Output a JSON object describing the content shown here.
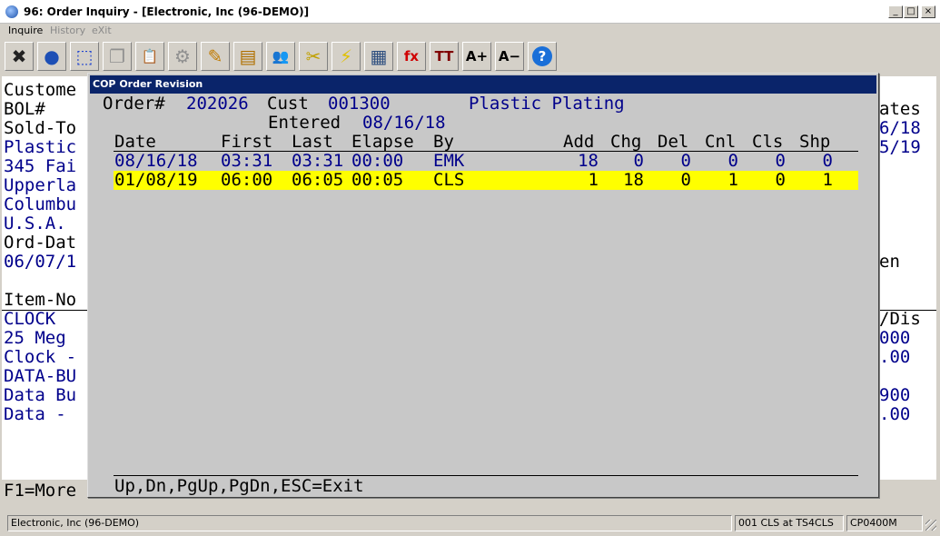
{
  "window": {
    "title": "96: Order Inquiry - [Electronic, Inc (96-DEMO)]",
    "buttons": {
      "minimize": "_",
      "maximize": "□",
      "close": "×"
    }
  },
  "menu": [
    {
      "label": "Inquire",
      "enabled": true
    },
    {
      "label": "History",
      "enabled": false
    },
    {
      "label": "eXit",
      "enabled": false
    }
  ],
  "toolbar": [
    {
      "icon": "close-x-icon",
      "glyph": "✖",
      "color": "#222222"
    },
    {
      "icon": "globe-icon",
      "glyph": "●",
      "color": "#1d4fb5"
    },
    {
      "icon": "select-icon",
      "glyph": "⬚",
      "color": "#1a3fd0"
    },
    {
      "icon": "copy-icon",
      "glyph": "❐",
      "color": "#909090"
    },
    {
      "icon": "paste-icon",
      "glyph": "📋",
      "color": "#909090"
    },
    {
      "icon": "gear-icon",
      "glyph": "⚙",
      "color": "#909090"
    },
    {
      "icon": "edit-icon",
      "glyph": "✎",
      "color": "#c07a00"
    },
    {
      "icon": "notepad-icon",
      "glyph": "▤",
      "color": "#b07000"
    },
    {
      "icon": "users-icon",
      "glyph": "👥",
      "color": "#2a7a2a"
    },
    {
      "icon": "tag-icon",
      "glyph": "✂",
      "color": "#c0a000"
    },
    {
      "icon": "lightning-icon",
      "glyph": "⚡",
      "color": "#e0c000"
    },
    {
      "icon": "calendar-lightning-icon",
      "glyph": "▦",
      "color": "#305080"
    },
    {
      "icon": "function-icon",
      "glyph": "fx",
      "color": "#d00000"
    },
    {
      "icon": "font-icon",
      "glyph": "TT",
      "color": "#800000"
    },
    {
      "icon": "font-increase-icon",
      "glyph": "A+",
      "color": "#000000"
    },
    {
      "icon": "font-decrease-icon",
      "glyph": "A−",
      "color": "#000000"
    },
    {
      "icon": "help-icon",
      "glyph": "?",
      "color": "#1a6fd8"
    }
  ],
  "background_screen": {
    "left_lines": [
      {
        "text": "Custome",
        "color": "black"
      },
      {
        "text": "BOL#",
        "color": "black"
      },
      {
        "text": "Sold-To",
        "color": "black"
      },
      {
        "text": "Plastic",
        "color": "blue"
      },
      {
        "text": "345 Fai",
        "color": "blue"
      },
      {
        "text": "Upperla",
        "color": "blue"
      },
      {
        "text": "Columbu",
        "color": "blue"
      },
      {
        "text": "U.S.A.",
        "color": "blue"
      },
      {
        "text": "Ord-Dat",
        "color": "black"
      },
      {
        "text": "06/07/1",
        "color": "blue"
      },
      {
        "text": "",
        "color": "black"
      },
      {
        "text": "Item-No",
        "color": "black"
      },
      {
        "text": "CLOCK",
        "color": "blue"
      },
      {
        "text": "25 Meg",
        "color": "blue"
      },
      {
        "text": "Clock -",
        "color": "blue"
      },
      {
        "text": "DATA-BU",
        "color": "blue"
      },
      {
        "text": "Data Bu",
        "color": "blue"
      },
      {
        "text": "Data -",
        "color": "blue"
      }
    ],
    "right_lines": [
      {
        "text": "ates",
        "color": "black"
      },
      {
        "text": "6/18",
        "color": "blue"
      },
      {
        "text": "5/19",
        "color": "blue"
      },
      {
        "text": "",
        "color": "black"
      },
      {
        "text": "",
        "color": "black"
      },
      {
        "text": "",
        "color": "black"
      },
      {
        "text": "",
        "color": "black"
      },
      {
        "text": "",
        "color": "black"
      },
      {
        "text": "en",
        "color": "black"
      },
      {
        "text": "",
        "color": "black"
      },
      {
        "text": "",
        "color": "black"
      },
      {
        "text": "/Dis",
        "color": "black"
      },
      {
        "text": "000",
        "color": "blue"
      },
      {
        "text": ".00",
        "color": "blue"
      },
      {
        "text": "",
        "color": "black"
      },
      {
        "text": "900",
        "color": "blue"
      },
      {
        "text": ".00",
        "color": "blue"
      }
    ],
    "f1_text": "F1=More"
  },
  "dialog": {
    "title": "COP Order Revision",
    "order_label": "Order#",
    "order_number": "202026",
    "cust_label": "Cust",
    "cust_number": "001300",
    "cust_name": "Plastic Plating",
    "entered_label": "Entered",
    "entered_date": "08/16/18",
    "columns": [
      "Date",
      "First",
      "Last",
      "Elapse",
      "By",
      "Add",
      "Chg",
      "Del",
      "Cnl",
      "Cls",
      "Shp"
    ],
    "rows": [
      {
        "date": "08/16/18",
        "first": "03:31",
        "last": "03:31",
        "elapse": "00:00",
        "by": "EMK",
        "add": "18",
        "chg": "0",
        "del": "0",
        "cnl": "0",
        "cls": "0",
        "shp": "0",
        "selected": false
      },
      {
        "date": "01/08/19",
        "first": "06:00",
        "last": "06:05",
        "elapse": "00:05",
        "by": "CLS",
        "add": "1",
        "chg": "18",
        "del": "0",
        "cnl": "1",
        "cls": "0",
        "shp": "1",
        "selected": true
      }
    ],
    "footer": "Up,Dn,PgUp,PgDn,ESC=Exit"
  },
  "status": {
    "company": "Electronic, Inc (96-DEMO)",
    "user": "001 CLS at TS4CLS",
    "program": "CP0400M"
  },
  "colors": {
    "term_blue": "#00008b",
    "highlight": "#ffff00",
    "dialog_title_bg": "#0a246a"
  }
}
